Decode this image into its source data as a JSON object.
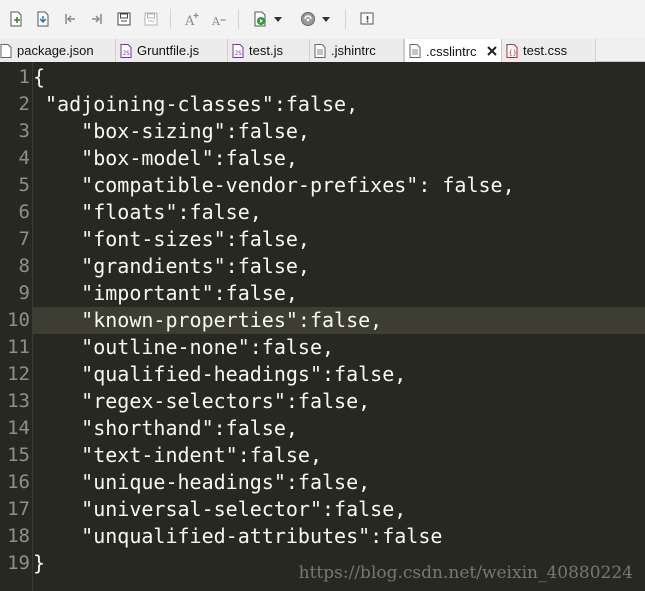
{
  "toolbar": {
    "buttons": [
      {
        "icon": "new-file-icon"
      },
      {
        "icon": "open-file-icon"
      },
      {
        "icon": "step-back-icon"
      },
      {
        "icon": "step-forward-icon"
      },
      {
        "icon": "save-icon"
      },
      {
        "icon": "save-all-icon"
      },
      {
        "icon": "font-increase-icon"
      },
      {
        "icon": "font-decrease-icon"
      },
      {
        "icon": "run-icon"
      },
      {
        "icon": "debug-icon"
      },
      {
        "icon": "info-icon"
      }
    ],
    "font_increase_glyph": "A",
    "font_decrease_glyph": "A",
    "info_glyph": "!"
  },
  "tabs": [
    {
      "label": "package.json",
      "icon": "json-file-icon",
      "active": false
    },
    {
      "label": "Gruntfile.js",
      "icon": "js-file-icon",
      "active": false
    },
    {
      "label": "test.js",
      "icon": "js-file-icon",
      "active": false
    },
    {
      "label": ".jshintrc",
      "icon": "text-file-icon",
      "active": false
    },
    {
      "label": ".csslintrc",
      "icon": "text-file-icon",
      "active": true
    },
    {
      "label": "test.css",
      "icon": "css-file-icon",
      "active": false
    }
  ],
  "editor": {
    "current_line": 10,
    "line_numbers": [
      "1",
      "2",
      "3",
      "4",
      "5",
      "6",
      "7",
      "8",
      "9",
      "10",
      "11",
      "12",
      "13",
      "14",
      "15",
      "16",
      "17",
      "18",
      "19"
    ],
    "lines": [
      "{",
      " \"adjoining-classes\":false,",
      "    \"box-sizing\":false,",
      "    \"box-model\":false,",
      "    \"compatible-vendor-prefixes\": false,",
      "    \"floats\":false,",
      "    \"font-sizes\":false,",
      "    \"grandients\":false,",
      "    \"important\":false,",
      "    \"known-properties\":false,",
      "    \"outline-none\":false,",
      "    \"qualified-headings\":false,",
      "    \"regex-selectors\":false,",
      "    \"shorthand\":false,",
      "    \"text-indent\":false,",
      "    \"unique-headings\":false,",
      "    \"universal-selector\":false,",
      "    \"unqualified-attributes\":false",
      "}"
    ],
    "watermark": "https://blog.csdn.net/weixin_40880224",
    "colors": {
      "background": "#272822",
      "text": "#f8f8f2",
      "line_number": "#8f908a",
      "current_line": "#3e3d32"
    }
  }
}
